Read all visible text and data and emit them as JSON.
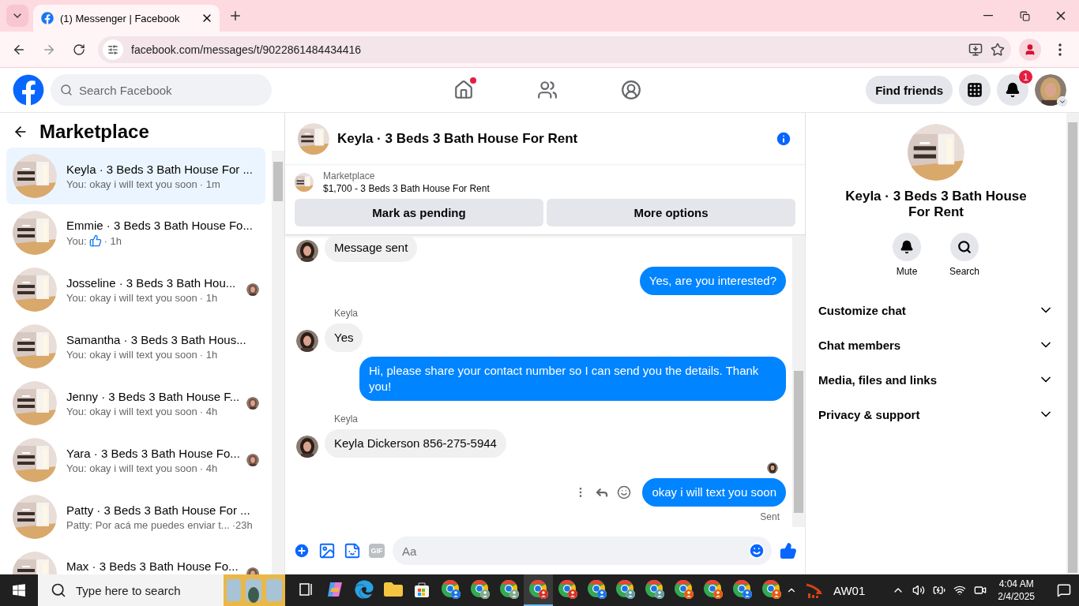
{
  "browser": {
    "tabs": [
      {
        "title": "(1) Messenger | Facebook",
        "selected": true
      }
    ],
    "url": "facebook.com/messages/t/9022861484434416"
  },
  "header": {
    "search_placeholder": "Search Facebook",
    "nav": [
      {
        "kind": "home",
        "notify": true
      },
      {
        "kind": "friends",
        "notify": false
      },
      {
        "kind": "groups",
        "notify": false
      }
    ],
    "find_friends": "Find friends",
    "notification_count": "1"
  },
  "sidebar": {
    "title": "Marketplace",
    "conversations": [
      {
        "name": "Keyla · 3 Beds 3 Bath House For ...",
        "preview": "You: okay i will text you soon",
        "kind": "text",
        "time": "· 1m",
        "selected": true,
        "seen": false
      },
      {
        "name": "Emmie · 3 Beds 3 Bath House Fo...",
        "preview": "You:",
        "kind": "like",
        "time": "· 1h",
        "selected": false,
        "seen": false
      },
      {
        "name": "Josseline · 3 Beds 3 Bath Hou...",
        "preview": "You: okay i will text you soon",
        "kind": "text",
        "time": "· 1h",
        "selected": false,
        "seen": true
      },
      {
        "name": "Samantha · 3 Beds 3 Bath Hous...",
        "preview": "You: okay i will text you soon",
        "kind": "text",
        "time": "· 1h",
        "selected": false,
        "seen": false
      },
      {
        "name": "Jenny · 3 Beds 3 Bath House F...",
        "preview": "You: okay i will text you soon",
        "kind": "text",
        "time": "· 4h",
        "selected": false,
        "seen": true
      },
      {
        "name": "Yara · 3 Beds 3 Bath House Fo...",
        "preview": "You: okay i will text you soon",
        "kind": "text",
        "time": "· 4h",
        "selected": false,
        "seen": true
      },
      {
        "name": "Patty · 3 Beds 3 Bath House For ...",
        "preview": "Patty: Por acá me puedes enviar t...",
        "kind": "text",
        "time": "·23h",
        "selected": false,
        "seen": false
      },
      {
        "name": "Max · 3 Beds 3 Bath House Fo...",
        "kind": "cut",
        "selected": false,
        "seen": true
      }
    ]
  },
  "chat": {
    "title": "Keyla · 3 Beds 3 Bath House For Rent",
    "listing": {
      "label": "Marketplace",
      "price": "$1,700 - 3 Beds 3 Bath House For Rent"
    },
    "buttons": [
      "Mark as pending",
      "More options"
    ],
    "messages": [
      {
        "kind": "incoming",
        "text": "Message sent"
      },
      {
        "kind": "outgoing",
        "text": "Yes, are you interested?"
      },
      {
        "kind": "incoming",
        "sender": "Keyla",
        "text": "Yes"
      },
      {
        "kind": "outgoing",
        "text": "Hi, please share your contact number so I can send you the details. Thank you!"
      },
      {
        "kind": "incoming",
        "sender": "Keyla",
        "text": "Keyla Dickerson 856-275-5944"
      },
      {
        "kind": "outgoing",
        "text": "okay i will text you soon",
        "seen": true,
        "hovered": true,
        "status": "Sent"
      }
    ],
    "composer": {
      "placeholder": "Aa",
      "gif": "GIF"
    }
  },
  "details": {
    "name": "Keyla · 3 Beds 3 Bath House For Rent",
    "actions": [
      {
        "kind": "mute",
        "label": "Mute"
      },
      {
        "kind": "search",
        "label": "Search"
      }
    ],
    "sections": [
      {
        "label": "Customize chat",
        "expanded": false
      },
      {
        "label": "Chat members",
        "expanded": false
      },
      {
        "label": "Media, files and links",
        "expanded": false
      },
      {
        "label": "Privacy & support",
        "expanded": false
      }
    ]
  },
  "taskbar": {
    "search_placeholder": "Type here to search",
    "apps": [
      {
        "kind": "taskview",
        "selected": false
      },
      {
        "kind": "copilot",
        "selected": false
      },
      {
        "kind": "edge",
        "selected": false
      },
      {
        "kind": "explorer",
        "selected": false
      },
      {
        "kind": "store",
        "selected": false
      },
      {
        "kind": "chrome",
        "color": "#1a73e8",
        "selected": false
      },
      {
        "kind": "chrome",
        "color": "#7fa88a",
        "selected": false
      },
      {
        "kind": "chrome",
        "color": "#7fa88a",
        "selected": false
      },
      {
        "kind": "chrome",
        "color": "#d93025",
        "selected": true
      },
      {
        "kind": "chrome",
        "color": "#d93025",
        "selected": false
      },
      {
        "kind": "chrome",
        "color": "#1a73e8",
        "selected": false
      },
      {
        "kind": "chrome",
        "color": "#5f9ea0",
        "selected": false
      },
      {
        "kind": "chrome",
        "color": "#5f9ea0",
        "selected": false
      },
      {
        "kind": "chrome",
        "color": "#e8590c",
        "selected": false
      },
      {
        "kind": "chrome",
        "color": "#e8590c",
        "selected": false
      },
      {
        "kind": "chrome",
        "color": "#1a73e8",
        "selected": false
      },
      {
        "kind": "chrome",
        "color": "#e8590c",
        "selected": false
      }
    ],
    "tray_label": "AW01",
    "time": "4:04 AM",
    "date": "2/4/2025"
  }
}
